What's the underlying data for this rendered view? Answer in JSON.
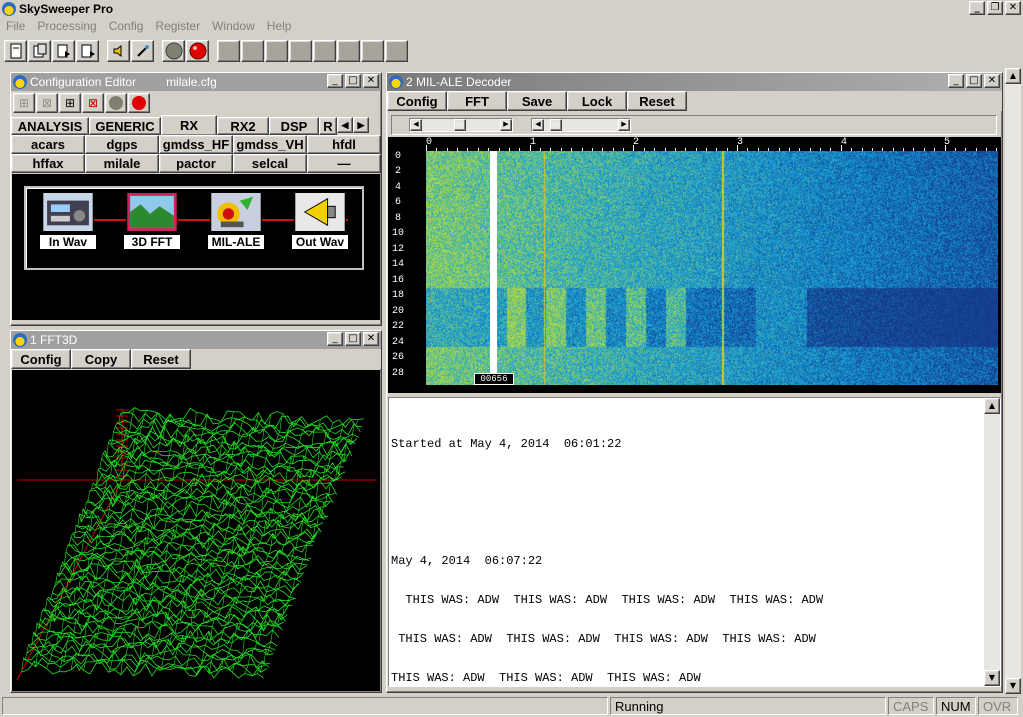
{
  "app": {
    "title": "SkySweeper Pro"
  },
  "menu": [
    "File",
    "Processing",
    "Config",
    "Register",
    "Window",
    "Help"
  ],
  "toolbar": {
    "icons": [
      "new-file-icon",
      "open-file-icon",
      "save-file-icon",
      "save-all-icon",
      "speaker-icon",
      "pin-icon",
      "stop-icon",
      "record-icon",
      "slot-1",
      "slot-2",
      "slot-3",
      "slot-4",
      "slot-5",
      "slot-6",
      "slot-7",
      "slot-8"
    ]
  },
  "config_editor": {
    "title": "Configuration Editor",
    "filename": "milale.cfg",
    "tabs": [
      "ANALYSIS",
      "GENERIC",
      "RX",
      "RX2",
      "DSP",
      "R"
    ],
    "row1": [
      "acars",
      "dgps",
      "gmdss_HF",
      "gmdss_VH",
      "hfdl"
    ],
    "row2": [
      "hffax",
      "milale",
      "pactor",
      "selcal",
      "—"
    ],
    "nodes": [
      "In Wav",
      "3D FFT",
      "MIL-ALE",
      "Out Wav"
    ]
  },
  "fft3d": {
    "title": "1 FFT3D",
    "buttons": [
      "Config",
      "Copy",
      "Reset"
    ]
  },
  "decoder": {
    "title": "2 MIL-ALE Decoder",
    "buttons": [
      "Config",
      "FFT",
      "Save",
      "Lock",
      "Reset"
    ],
    "x_ticks": [
      "0",
      "1",
      "2",
      "3",
      "4",
      "5"
    ],
    "y_ticks": [
      "0",
      "2",
      "4",
      "6",
      "8",
      "10",
      "12",
      "14",
      "16",
      "18",
      "20",
      "22",
      "24",
      "26",
      "28"
    ],
    "marker_label": "00656",
    "output_lines": [
      "Started at May 4, 2014  06:01:22",
      "",
      "",
      "May 4, 2014  06:07:22",
      "  THIS WAS: ADW  THIS WAS: ADW  THIS WAS: ADW  THIS WAS: ADW",
      " THIS WAS: ADW  THIS WAS: ADW  THIS WAS: ADW  THIS WAS: ADW",
      "THIS WAS: ADW  THIS WAS: ADW  THIS WAS: ADW"
    ]
  },
  "statusbar": {
    "status": "Running",
    "caps": "CAPS",
    "num": "NUM",
    "ovr": "OVR"
  },
  "colors": {
    "face": "#d4d0c8",
    "waterfall_bg": "#1a7fd0",
    "mesh": "#22dd22"
  }
}
